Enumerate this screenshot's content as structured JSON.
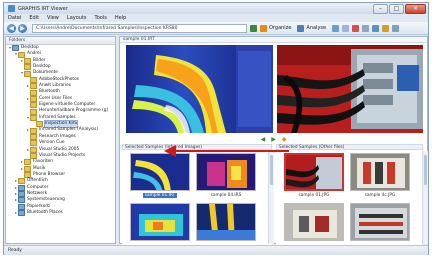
{
  "window": {
    "title": "GRAPHIS IRT Viewer",
    "controls": [
      "–",
      "□",
      "×"
    ]
  },
  "menu": [
    "Datei",
    "Edit",
    "View",
    "Layouts",
    "Tools",
    "Help"
  ],
  "toolbar": {
    "path": "C:\\Users\\Andre\\Documents\\Infrared Samples\\Inspection KRS80",
    "organize_label": "Organize",
    "analyse_label": "Analyse",
    "accent": "#e98a14"
  },
  "tree": {
    "header": "Folders",
    "items": [
      {
        "label": "Desktop",
        "depth": 0,
        "icon": "blue",
        "expander": "▾"
      },
      {
        "label": "Andrei",
        "depth": 1,
        "icon": "folder",
        "expander": "▾"
      },
      {
        "label": "Bilder",
        "depth": 2,
        "icon": "folder",
        "expander": "▸"
      },
      {
        "label": "Desktop",
        "depth": 2,
        "icon": "folder",
        "expander": ""
      },
      {
        "label": "Dokumente",
        "depth": 2,
        "icon": "folder",
        "expander": "▾"
      },
      {
        "label": "AdobeStockPhotos",
        "depth": 3,
        "icon": "folder",
        "expander": ""
      },
      {
        "label": "Anwlt Libraries",
        "depth": 3,
        "icon": "folder",
        "expander": "▸"
      },
      {
        "label": "Bluetooth",
        "depth": 3,
        "icon": "folder",
        "expander": ""
      },
      {
        "label": "Corel User Files",
        "depth": 3,
        "icon": "folder",
        "expander": "▸"
      },
      {
        "label": "Eigene virtuelle Computer",
        "depth": 3,
        "icon": "folder",
        "expander": ""
      },
      {
        "label": "Herunterladbare Programme (g)",
        "depth": 3,
        "icon": "folder",
        "expander": ""
      },
      {
        "label": "Infrared Samples",
        "depth": 3,
        "icon": "folder",
        "expander": "▾"
      },
      {
        "label": "Inspection KRS",
        "depth": 4,
        "icon": "folder",
        "expander": "",
        "selected": true
      },
      {
        "label": "Infrared Samples (Analysis)",
        "depth": 3,
        "icon": "folder",
        "expander": "▸"
      },
      {
        "label": "Research Images",
        "depth": 3,
        "icon": "folder",
        "expander": ""
      },
      {
        "label": "Version Cue",
        "depth": 3,
        "icon": "folder",
        "expander": ""
      },
      {
        "label": "Visual Studio 2005",
        "depth": 3,
        "icon": "folder",
        "expander": "▸"
      },
      {
        "label": "Visual Studio Projects",
        "depth": 3,
        "icon": "folder",
        "expander": ""
      },
      {
        "label": "Favoriten",
        "depth": 2,
        "icon": "folder",
        "expander": "▸"
      },
      {
        "label": "Musik",
        "depth": 2,
        "icon": "folder",
        "expander": "▸"
      },
      {
        "label": "Phone Browser",
        "depth": 2,
        "icon": "folder",
        "expander": ""
      },
      {
        "label": "Öffentlich",
        "depth": 1,
        "icon": "folder",
        "expander": "▸"
      },
      {
        "label": "Computer",
        "depth": 1,
        "icon": "blue",
        "expander": "▸"
      },
      {
        "label": "Netzwerk",
        "depth": 1,
        "icon": "blue",
        "expander": "▸"
      },
      {
        "label": "Systemsteuerung",
        "depth": 1,
        "icon": "blue",
        "expander": "▸"
      },
      {
        "label": "Papierkorb",
        "depth": 1,
        "icon": "blue",
        "expander": ""
      },
      {
        "label": "Bluetooth Places",
        "depth": 1,
        "icon": "blue",
        "expander": "▸"
      }
    ]
  },
  "viewer": {
    "caption": "sample 01.IRT",
    "nav_glyphs": [
      "◀",
      "▶",
      "◆"
    ]
  },
  "grids": {
    "left_header": "Selected Samples (Infrared Images)",
    "right_header": "Selected Samples (Other files)",
    "left_thumbs": [
      {
        "caption": "sample 01.IRT",
        "style": "ir1",
        "selected": true
      },
      {
        "caption": "sample 04.IRS",
        "style": "ir2",
        "selected": false
      },
      {
        "caption": "",
        "style": "ir3",
        "selected": false
      },
      {
        "caption": "",
        "style": "ir4",
        "selected": false
      }
    ],
    "right_thumbs": [
      {
        "caption": "sample 01.JPG",
        "style": "ph1",
        "selected": true
      },
      {
        "caption": "sample 4c.JPG",
        "style": "ph2",
        "selected": false
      },
      {
        "caption": "",
        "style": "ph3",
        "selected": false
      },
      {
        "caption": "",
        "style": "ph4",
        "selected": false
      }
    ]
  },
  "status": {
    "text": "Ready"
  }
}
